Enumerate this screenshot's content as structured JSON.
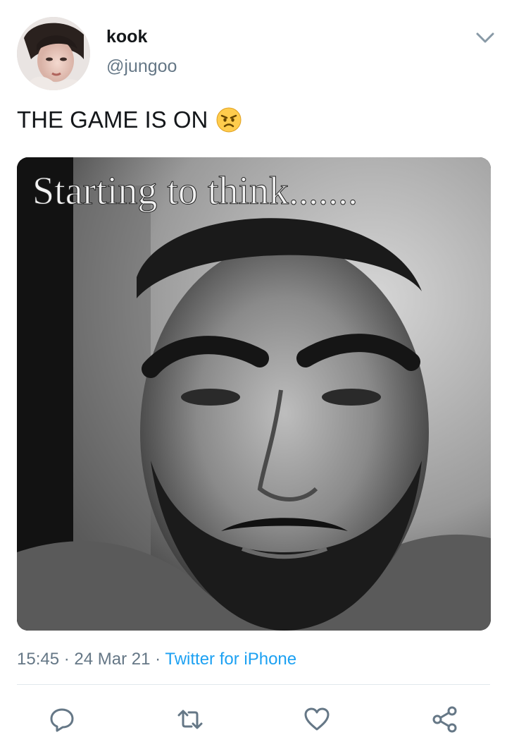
{
  "tweet": {
    "author": {
      "display_name": "kook",
      "handle": "@jungoo"
    },
    "text": "THE GAME IS ON",
    "emoji": "angry-face-emoji",
    "media": {
      "caption": "Starting to think......."
    },
    "meta": {
      "time": "15:45",
      "separator": " · ",
      "date": "24 Mar 21",
      "source": "Twitter for iPhone"
    }
  },
  "icons": {
    "menu": "chevron-down-icon",
    "reply": "reply-icon",
    "retweet": "retweet-icon",
    "like": "heart-icon",
    "share": "share-icon"
  },
  "colors": {
    "text_primary": "#14171a",
    "text_secondary": "#657786",
    "link": "#1da1f2",
    "divider": "#e1e8ed"
  }
}
